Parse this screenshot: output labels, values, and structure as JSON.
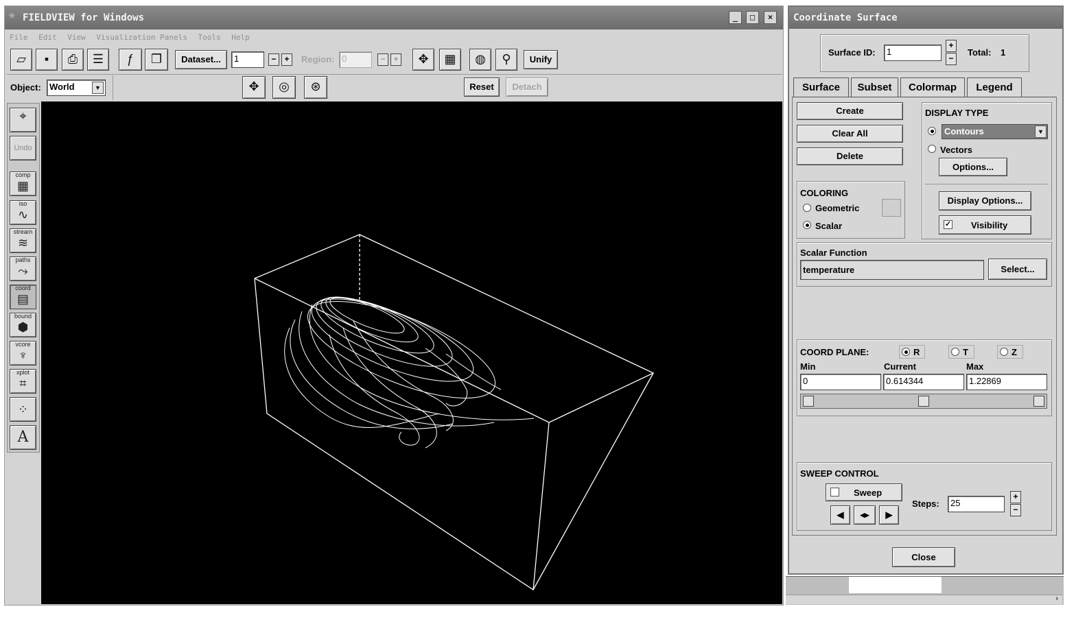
{
  "main_window": {
    "title": "FIELDVIEW for Windows",
    "menu": [
      "File",
      "Edit",
      "View",
      "Visualization Panels",
      "Tools",
      "Help"
    ],
    "toolbar": {
      "dataset_label": "Dataset...",
      "dataset_value": "1",
      "region_label": "Region:",
      "region_value": "0",
      "unify_label": "Unify"
    },
    "object_bar": {
      "object_label": "Object:",
      "object_value": "World",
      "reset_label": "Reset",
      "detach_label": "Detach"
    },
    "side_tools": [
      {
        "id": "cursor",
        "label": ""
      },
      {
        "id": "undo",
        "label": "Undo"
      },
      {
        "id": "comp",
        "label": "comp"
      },
      {
        "id": "iso",
        "label": "iso"
      },
      {
        "id": "stream",
        "label": "stream"
      },
      {
        "id": "paths",
        "label": "paths"
      },
      {
        "id": "coord",
        "label": "coord"
      },
      {
        "id": "bound",
        "label": "bound"
      },
      {
        "id": "vcore",
        "label": "vcore"
      },
      {
        "id": "xplot",
        "label": "xplot"
      },
      {
        "id": "probe",
        "label": ""
      },
      {
        "id": "text",
        "label": "A"
      }
    ]
  },
  "panel": {
    "title": "Coordinate Surface",
    "surface_id_label": "Surface ID:",
    "surface_id_value": "1",
    "total_label": "Total:",
    "total_value": "1",
    "tabs": [
      "Surface",
      "Subset",
      "Colormap",
      "Legend"
    ],
    "active_tab": "Surface",
    "create_label": "Create",
    "clear_all_label": "Clear All",
    "delete_label": "Delete",
    "display_type_label": "DISPLAY TYPE",
    "contours_label": "Contours",
    "vectors_label": "Vectors",
    "options_label": "Options...",
    "coloring_label": "COLORING",
    "geometric_label": "Geometric",
    "scalar_label": "Scalar",
    "display_options_label": "Display Options...",
    "visibility_label": "Visibility",
    "scalar_function_label": "Scalar Function",
    "scalar_function_value": "temperature",
    "select_label": "Select...",
    "coord_plane_label": "COORD PLANE:",
    "plane_r": "R",
    "plane_t": "T",
    "plane_z": "Z",
    "min_label": "Min",
    "current_label": "Current",
    "max_label": "Max",
    "min_value": "0",
    "current_value": "0.614344",
    "max_value": "1.22869",
    "slider_fraction": 0.5,
    "sweep_control_label": "SWEEP CONTROL",
    "sweep_label": "Sweep",
    "steps_label": "Steps:",
    "steps_value": "25",
    "close_label": "Close"
  },
  "colors": {
    "viewport_background": "#000000",
    "wireframe": "#ffffff"
  }
}
